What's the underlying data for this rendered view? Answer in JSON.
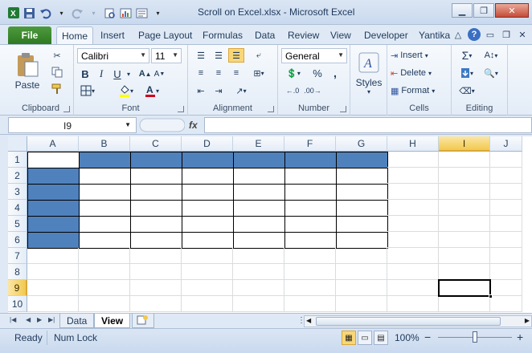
{
  "window": {
    "title": "Scroll on Excel.xlsx - Microsoft Excel"
  },
  "quick_access": [
    "excel-logo-icon",
    "save-icon",
    "undo-icon",
    "redo-icon",
    "print-preview-icon",
    "chart-icon",
    "form-icon",
    "customize-icon"
  ],
  "ribbon_tabs": [
    {
      "label": "File",
      "active": false
    },
    {
      "label": "Home",
      "active": true
    },
    {
      "label": "Insert",
      "active": false
    },
    {
      "label": "Page Layout",
      "active": false
    },
    {
      "label": "Formulas",
      "active": false
    },
    {
      "label": "Data",
      "active": false
    },
    {
      "label": "Review",
      "active": false
    },
    {
      "label": "View",
      "active": false
    },
    {
      "label": "Developer",
      "active": false
    },
    {
      "label": "Yantika",
      "active": false
    }
  ],
  "ribbon": {
    "clipboard": {
      "paste": "Paste",
      "label": "Clipboard"
    },
    "font": {
      "name": "Calibri",
      "size": "11",
      "label": "Font",
      "bold": "B",
      "italic": "I",
      "underline": "U"
    },
    "alignment": {
      "label": "Alignment"
    },
    "number": {
      "format": "General",
      "label": "Number",
      "percent": "%"
    },
    "styles": {
      "label": "Styles"
    },
    "cells": {
      "insert": "Insert",
      "delete": "Delete",
      "format": "Format",
      "label": "Cells"
    },
    "editing": {
      "label": "Editing"
    }
  },
  "formula_bar": {
    "name_box": "I9",
    "fx": "fx",
    "value": ""
  },
  "grid": {
    "columns": [
      "A",
      "B",
      "C",
      "D",
      "E",
      "F",
      "G",
      "H",
      "I",
      "J"
    ],
    "rows": [
      "1",
      "2",
      "3",
      "4",
      "5",
      "6",
      "7",
      "8",
      "9",
      "10"
    ],
    "selected_column": "I",
    "selected_row": "9",
    "fill_color": "#4F81BD"
  },
  "sheets": [
    {
      "label": "Data",
      "active": false
    },
    {
      "label": "View",
      "active": true
    }
  ],
  "status": {
    "ready": "Ready",
    "num_lock": "Num Lock",
    "zoom": "100%",
    "zoom_out": "−",
    "zoom_in": "+"
  }
}
